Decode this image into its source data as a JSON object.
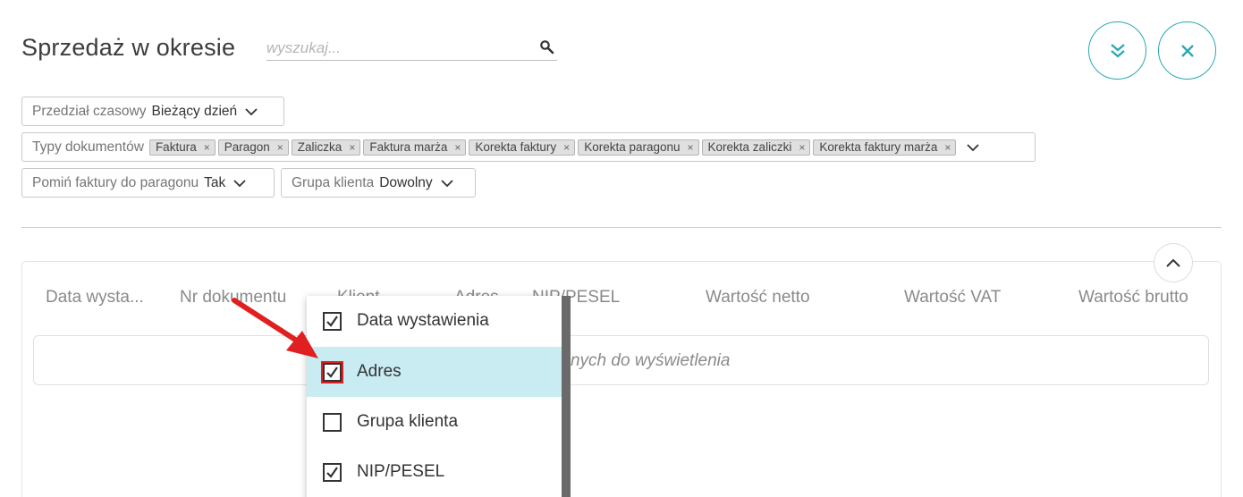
{
  "header": {
    "title": "Sprzedaż w okresie",
    "search_placeholder": "wyszukaj..."
  },
  "filters": {
    "time": {
      "label": "Przedział czasowy",
      "value": "Bieżący dzień"
    },
    "types": {
      "label": "Typy dokumentów",
      "tags": [
        "Faktura",
        "Paragon",
        "Zaliczka",
        "Faktura marża",
        "Korekta faktury",
        "Korekta paragonu",
        "Korekta zaliczki",
        "Korekta faktury marża"
      ]
    },
    "skip": {
      "label": "Pomiń faktury do paragonu",
      "value": "Tak"
    },
    "group": {
      "label": "Grupa klienta",
      "value": "Dowolny"
    }
  },
  "grid": {
    "columns": [
      "Data wysta...",
      "Nr dokumentu",
      "Klient",
      "Adres",
      "NIP/PESEL",
      "Wartość netto",
      "Wartość VAT",
      "Wartość brutto"
    ],
    "empty_text": "Brak danych do wyświetlenia"
  },
  "column_chooser": {
    "items": [
      {
        "label": "Data wystawienia",
        "checked": true
      },
      {
        "label": "Adres",
        "checked": true
      },
      {
        "label": "Grupa klienta",
        "checked": false
      },
      {
        "label": "NIP/PESEL",
        "checked": true
      }
    ]
  },
  "colors": {
    "accent": "#2aa7b3",
    "highlight": "#c9ecf3",
    "annotation": "#e02020"
  }
}
